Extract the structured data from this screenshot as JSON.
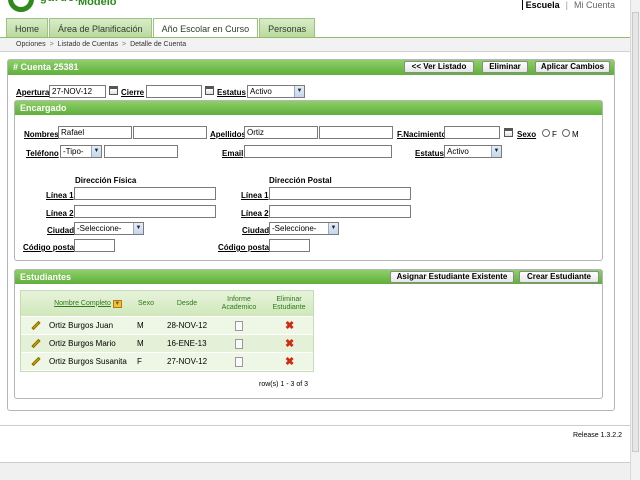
{
  "header": {
    "logo_word": "garden",
    "app_name": "Escuela Modelo",
    "links": [
      "Escuela",
      "Mi Cuenta"
    ]
  },
  "tabs": [
    {
      "label": "Home",
      "active": false
    },
    {
      "label": "Área de Planificación",
      "active": false
    },
    {
      "label": "Año Escolar en Curso",
      "active": true
    },
    {
      "label": "Personas",
      "active": false
    }
  ],
  "breadcrumb": [
    "Opciones",
    "Listado de Cuentas",
    "Detalle de Cuenta"
  ],
  "account": {
    "title": "# Cuenta 25381",
    "buttons": {
      "back": "<< Ver Listado",
      "delete": "Eliminar",
      "apply": "Aplicar Cambios"
    },
    "apertura_label": "Apertura",
    "apertura_value": "27-NOV-12",
    "cierre_label": "Cierre",
    "cierre_value": "",
    "estatus_label": "Estatus",
    "estatus_value": "Activo"
  },
  "encargado": {
    "title": "Encargado",
    "nombres_label": "Nombres",
    "nombres_value": "Rafael",
    "nombres2_value": "",
    "apellidos_label": "Apellidos",
    "apellidos_value": "Ortiz",
    "apellidos2_value": "",
    "fnac_label": "F.Nacimiento",
    "fnac_value": "",
    "sexo_label": "Sexo",
    "sexo_f": "F",
    "sexo_m": "M",
    "telefono_label": "Teléfono",
    "telefono_tipo": "-Tipo-",
    "telefono_value": "",
    "email_label": "Email",
    "email_value": "",
    "estatus_label": "Estatus",
    "estatus_value": "Activo",
    "fisica": {
      "title": "Dirección Física",
      "linea1_label": "Línea 1",
      "linea1_value": "",
      "linea2_label": "Línea 2",
      "linea2_value": "",
      "ciudad_label": "Ciudad",
      "ciudad_value": "-Seleccione-",
      "cp_label": "Código postal",
      "cp_value": ""
    },
    "postal": {
      "title": "Dirección Postal",
      "linea1_label": "Línea 1",
      "linea1_value": "",
      "linea2_label": "Línea 2",
      "linea2_value": "",
      "ciudad_label": "Ciudad",
      "ciudad_value": "-Seleccione-",
      "cp_label": "Código postal",
      "cp_value": ""
    }
  },
  "estudiantes": {
    "title": "Estudiantes",
    "buttons": {
      "assign": "Asignar Estudiante Existente",
      "create": "Crear Estudiante"
    },
    "columns": {
      "nombre": "Nombre Completo",
      "sexo": "Sexo",
      "desde": "Desde",
      "informe": "Informe Academico",
      "eliminar": "Eliminar Estudiante"
    },
    "rows": [
      {
        "nombre": "Ortiz Burgos Juan",
        "sexo": "M",
        "desde": "28-NOV-12"
      },
      {
        "nombre": "Ortiz Burgos Mario",
        "sexo": "M",
        "desde": "16-ENE-13"
      },
      {
        "nombre": "Ortiz Burgos Susanita",
        "sexo": "F",
        "desde": "27-NOV-12"
      }
    ],
    "pagination": "row(s) 1 - 3 of 3"
  },
  "footer": {
    "release": "Release 1.3.2.2"
  },
  "colors": {
    "accent": "#5fae3a",
    "brand": "#2f8a1e",
    "delete": "#d42a10"
  },
  "icons": [
    "calendar-icon",
    "pencil-icon",
    "document-icon",
    "delete-icon",
    "sort-icon"
  ]
}
